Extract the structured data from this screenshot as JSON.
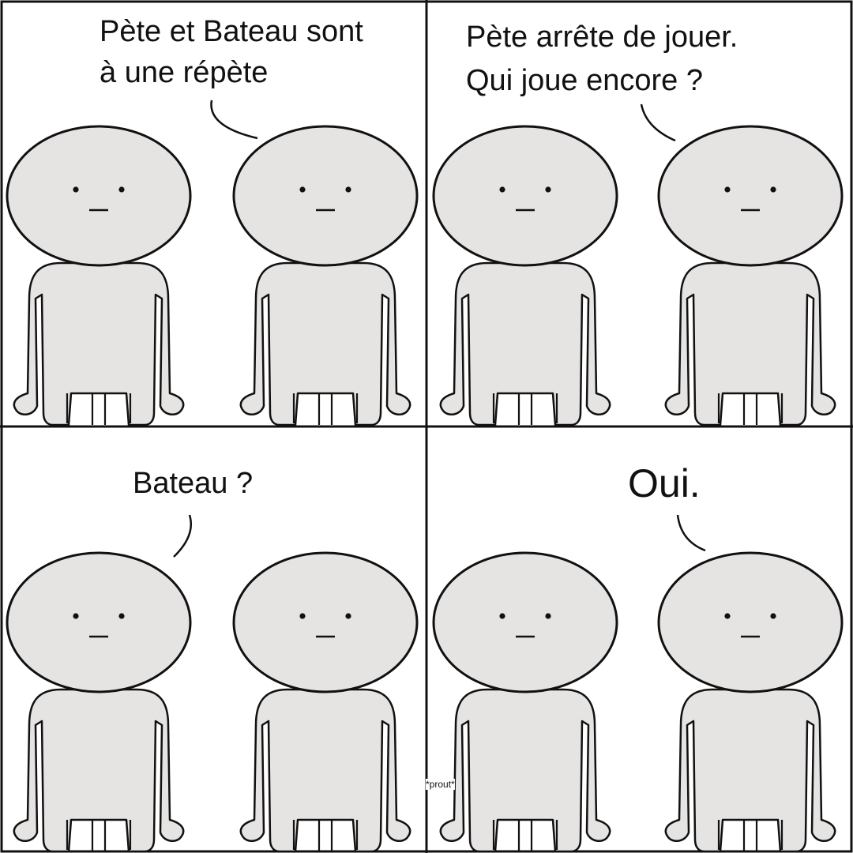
{
  "panels": [
    {
      "caption_lines": [
        "Pète et Bateau sont",
        "à une répète"
      ]
    },
    {
      "caption_lines": [
        "Pète arrête de jouer.",
        "Qui joue encore ?"
      ]
    },
    {
      "caption_lines": [
        "Bateau ?"
      ]
    },
    {
      "caption_lines": [
        "Oui."
      ]
    }
  ],
  "sound_effect": "*prout*",
  "colors": {
    "background": "#ffffff",
    "figure_fill": "#e6e3e3",
    "ink": "#111111"
  }
}
